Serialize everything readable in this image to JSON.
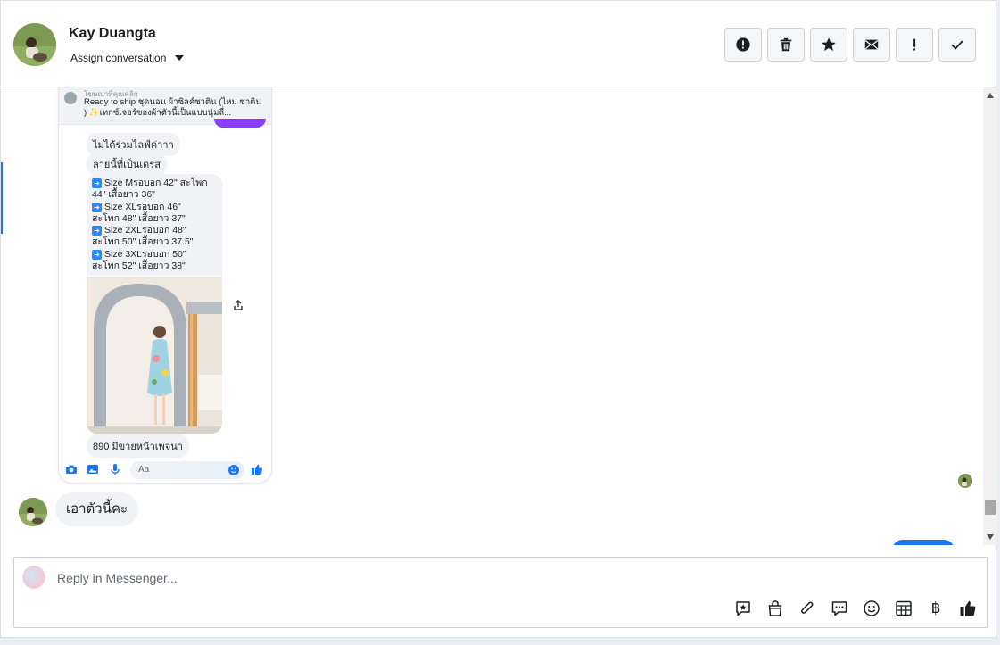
{
  "header": {
    "contact_name": "Kay Duangta",
    "assign_label": "Assign conversation",
    "actions": [
      {
        "name": "mark-spam-button",
        "icon": "alert-circle-icon"
      },
      {
        "name": "delete-button",
        "icon": "trash-icon"
      },
      {
        "name": "star-button",
        "icon": "star-icon"
      },
      {
        "name": "mark-unread-button",
        "icon": "envelope-icon"
      },
      {
        "name": "follow-up-button",
        "icon": "exclamation-icon"
      },
      {
        "name": "mark-done-button",
        "icon": "checkmark-icon"
      }
    ]
  },
  "shared_screenshot": {
    "ad_subtitle": "โฆษณาที่คุณคลิก",
    "ad_text": "Ready to ship ชุดนอน ผ้าซิลค์ซาติน (ไหม ซาติน ) ✨เทกซ์เจอร์ของผ้าตัวนี้เป็นแบบนุ่มลื่...",
    "bubble_1": "ไม่ได้ร่วมไลฟ์ค่าาา",
    "bubble_2": "ลายนี้ที่เป็นเดรส",
    "size_lines": [
      "Size Mรอบอก 42\" สะโพก",
      "44\" เสื้อยาว 36\"",
      "Size XLรอบอก 46\"",
      "สะโพก 48\" เสื้อยาว 37\"",
      "Size 2XLรอบอก 48\"",
      "สะโพก 50\" เสื้อยาว 37.5\"",
      "Size 3XLรอบอก 50\"",
      "สะโพก 52\" เสื้อยาว 38\""
    ],
    "price_text": "890 มีขายหน้าเพจนา",
    "composer_placeholder": "Aa"
  },
  "messages": [
    {
      "text": "เอาตัวนี้คะ",
      "from": "customer"
    }
  ],
  "reply": {
    "placeholder": "Reply in Messenger..."
  },
  "colors": {
    "accent": "#1877f2",
    "purple": "#8a3ffc",
    "bubble_gray": "#f0f2f5"
  }
}
